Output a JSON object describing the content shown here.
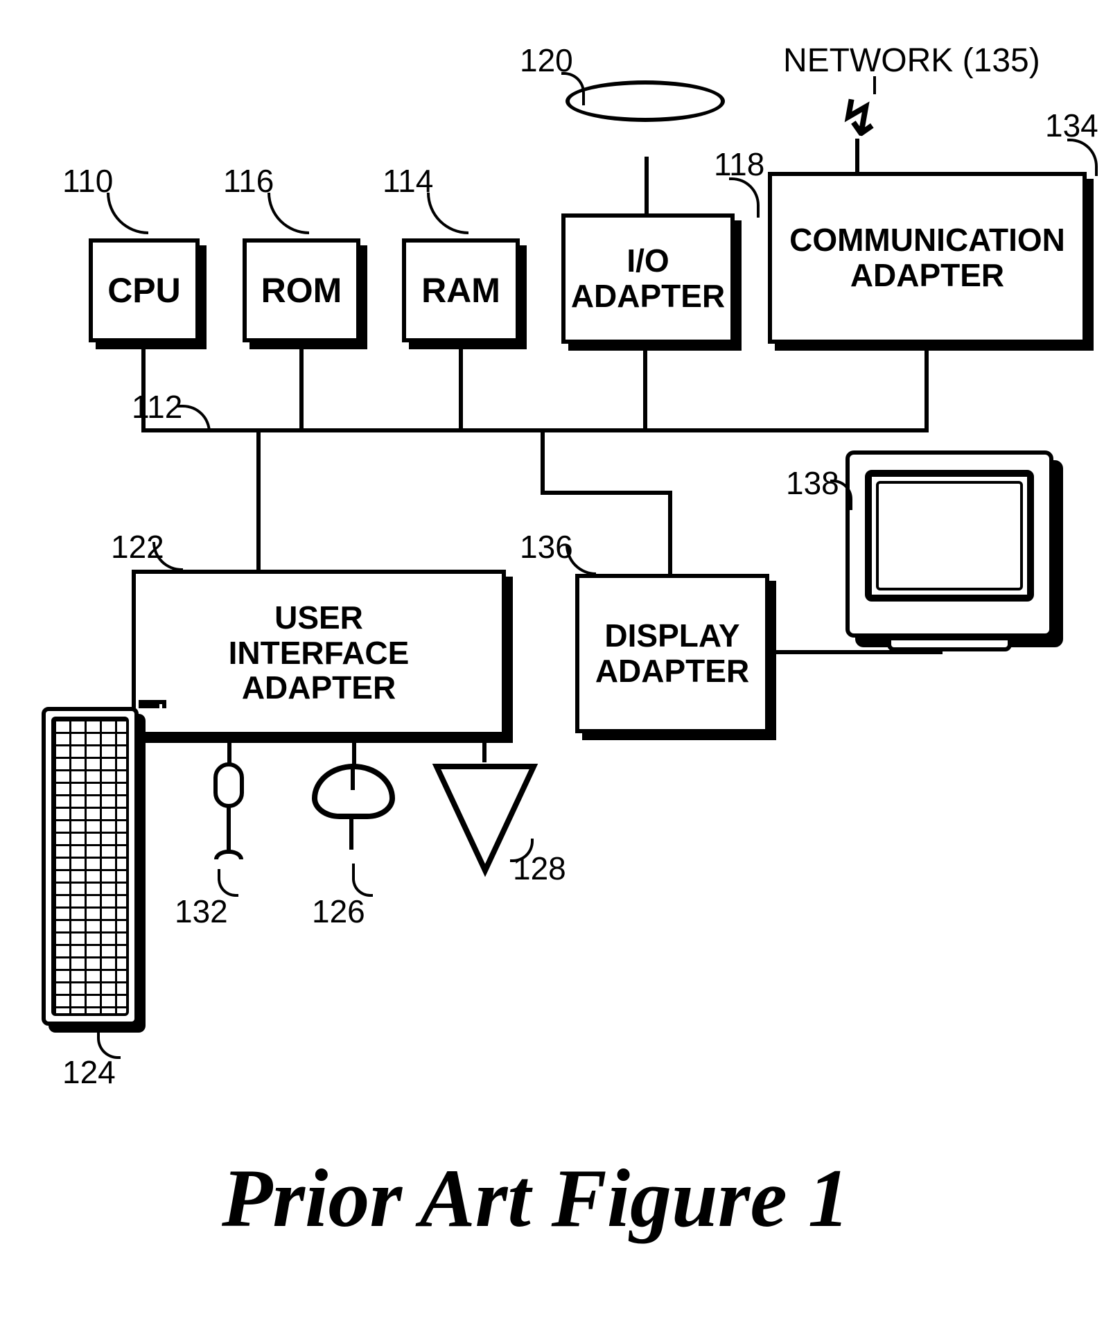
{
  "caption": "Prior Art Figure 1",
  "labels": {
    "cpu_num": "110",
    "rom_num": "116",
    "ram_num": "114",
    "io_num": "118",
    "disk_num": "120",
    "comm_num": "134",
    "network": "NETWORK (135)",
    "bus_num": "112",
    "ui_num": "122",
    "disp_num": "136",
    "kbd_num": "124",
    "mic_num": "132",
    "mouse_num": "126",
    "spk_num": "128",
    "mon_num": "138"
  },
  "boxes": {
    "cpu": "CPU",
    "rom": "ROM",
    "ram": "RAM",
    "io": "I/O\nADAPTER",
    "comm": "COMMUNICATION\nADAPTER",
    "ui": "USER\nINTERFACE\nADAPTER",
    "disp": "DISPLAY\nADAPTER"
  }
}
